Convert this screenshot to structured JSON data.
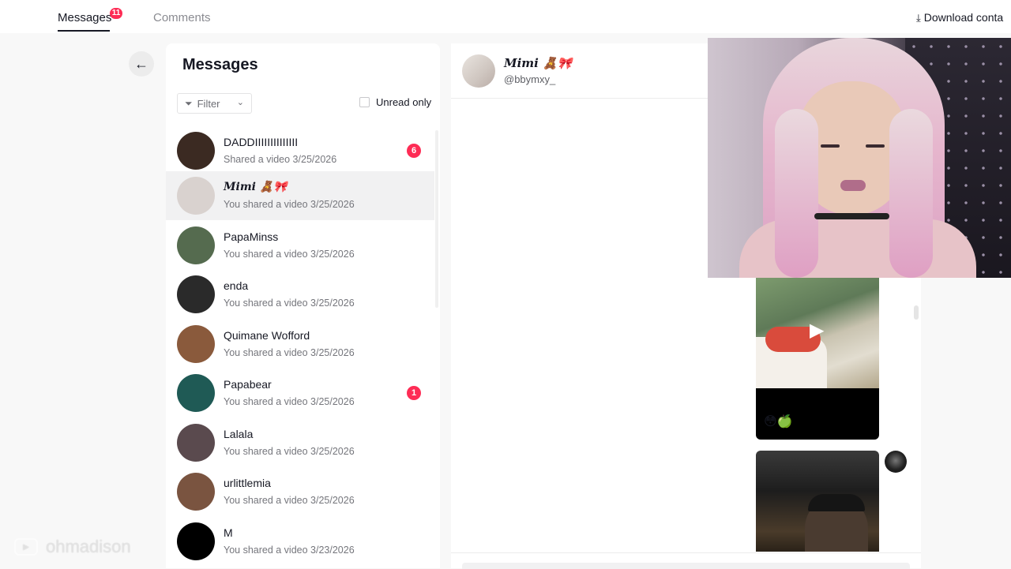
{
  "topbar": {
    "tabs": [
      {
        "label": "Messages",
        "badge": "11",
        "active": true
      },
      {
        "label": "Comments",
        "active": false
      }
    ],
    "download_label": "Download conta"
  },
  "messages_panel": {
    "title": "Messages",
    "filter_label": "Filter",
    "unread_only_label": "Unread only",
    "conversations": [
      {
        "name": "DADDIIIIIIIIIIIIII",
        "subtitle": "Shared a video 3/25/2026",
        "badge": "6",
        "avatar_color": "#3b2a22",
        "active": false
      },
      {
        "name": "𝑴𝒊𝒎𝒊 🧸🎀",
        "subtitle": "You shared a video 3/25/2026",
        "badge": "",
        "avatar_color": "#d9d2cf",
        "active": true
      },
      {
        "name": "PapaMinss",
        "subtitle": "You shared a video 3/25/2026",
        "badge": "",
        "avatar_color": "#556b4f",
        "active": false
      },
      {
        "name": "enda",
        "subtitle": "You shared a video 3/25/2026",
        "badge": "",
        "avatar_color": "#2a2a2a",
        "active": false
      },
      {
        "name": "Quimane Wofford",
        "subtitle": "You shared a video 3/25/2026",
        "badge": "",
        "avatar_color": "#8a5a3c",
        "active": false
      },
      {
        "name": "Papabear",
        "subtitle": "You shared a video 3/25/2026",
        "badge": "1",
        "avatar_color": "#1f5a55",
        "active": false
      },
      {
        "name": "Lalala",
        "subtitle": "You shared a video 3/25/2026",
        "badge": "",
        "avatar_color": "#5a4a4e",
        "active": false
      },
      {
        "name": "urlittlemia",
        "subtitle": "You shared a video 3/25/2026",
        "badge": "",
        "avatar_color": "#7a5440",
        "active": false
      },
      {
        "name": "M",
        "subtitle": "You shared a video 3/23/2026",
        "badge": "",
        "avatar_color": "#000000",
        "active": false
      }
    ]
  },
  "chat": {
    "name": "𝑴𝒊𝒎𝒊 🧸🎀",
    "handle": "@bbymxy_",
    "video1_caption": "😳🍏"
  },
  "overlay": {
    "watermark": "ohmadison"
  },
  "colors": {
    "accent": "#fe2c55",
    "text_primary": "#161823",
    "text_secondary": "#75767c",
    "active_row": "#f1f1f2"
  }
}
